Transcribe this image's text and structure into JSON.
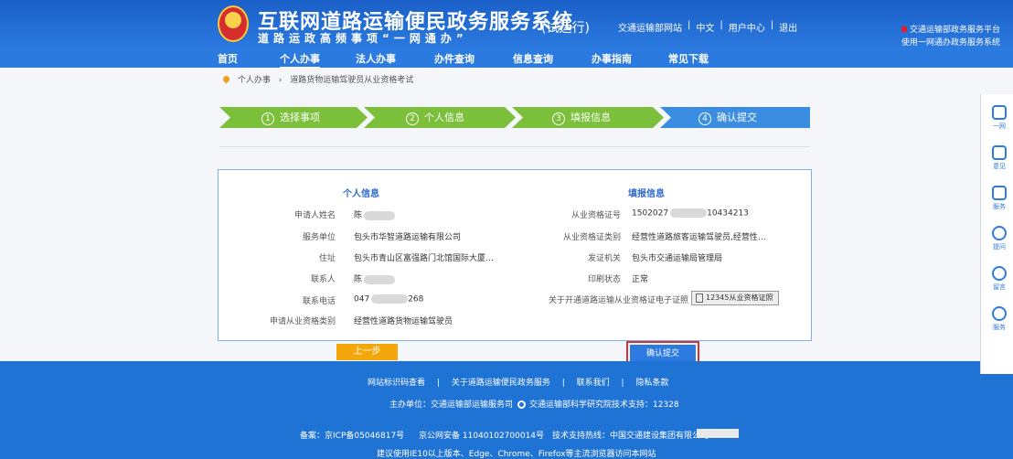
{
  "header": {
    "title": "互联网道路运输便民政务服务系统",
    "trial": "(试运行)",
    "slogan": "道路运政高频事项“一网通办”",
    "links": [
      "交通运输部网站",
      "中文",
      "用户中心",
      "退出"
    ],
    "notice": [
      "交通运输部政务服务平台",
      "使用一网通办政务服务系统"
    ]
  },
  "nav": [
    "首页",
    "个人办事",
    "法人办事",
    "办件查询",
    "信息查询",
    "办事指南",
    "常见下载"
  ],
  "breadcrumb": {
    "home": "个人办事",
    "sep": "›",
    "current": "道路货物运输驾驶员从业资格考试"
  },
  "steps": [
    {
      "num": "1",
      "label": "选择事项"
    },
    {
      "num": "2",
      "label": "个人信息"
    },
    {
      "num": "3",
      "label": "填报信息"
    },
    {
      "num": "4",
      "label": "确认提交"
    }
  ],
  "personal": {
    "heading": "个人信息",
    "rows": [
      {
        "label": "申请人姓名",
        "value": "陈"
      },
      {
        "label": "服务单位",
        "value": "包头市华智道路运输有限公司"
      },
      {
        "label": "住址",
        "value": "包头市青山区富强路门北馆国际大厦…"
      },
      {
        "label": "联系人",
        "value": "陈"
      },
      {
        "label": "联系电话",
        "value": "047",
        "value_tail": "268"
      },
      {
        "label": "申请从业资格类别",
        "value": "经营性道路货物运输驾驶员"
      }
    ]
  },
  "apply": {
    "heading": "填报信息",
    "rows": [
      {
        "label": "从业资格证号",
        "value": "1502027",
        "value_tail": "10434213"
      },
      {
        "label": "从业资格证类别",
        "value": "经营性道路旅客运输驾驶员,经营性…"
      },
      {
        "label": "发证机关",
        "value": "包头市交通运输局管理局"
      },
      {
        "label": "印刷状态",
        "value": "正常"
      },
      {
        "label": "关于开通道路运输从业资格证电子证照",
        "value": "12345从业资格证照"
      }
    ]
  },
  "buttons": {
    "back": "上一步",
    "confirm": "确认提交"
  },
  "footer": {
    "links": [
      "网站标识码查看",
      "|",
      "关于道路运输便民政务服务",
      "|",
      "联系我们",
      "|",
      "隐私条款"
    ],
    "host": "主办单位：交通运输部运输服务司",
    "support": "交通运输部科学研究院技术支持：12328",
    "icp": "备案：京ICP备05046817号",
    "police": "京公网安备 11040102700014号",
    "hotline": "技术支持热线：中国交通建设集团有限公司",
    "browser": "建议使用IE10以上版本、Edge、Chrome、Firefox等主流浏览器访问本网站"
  },
  "side": [
    "一网",
    "意见",
    "服务",
    "提问",
    "留言",
    "服务"
  ]
}
